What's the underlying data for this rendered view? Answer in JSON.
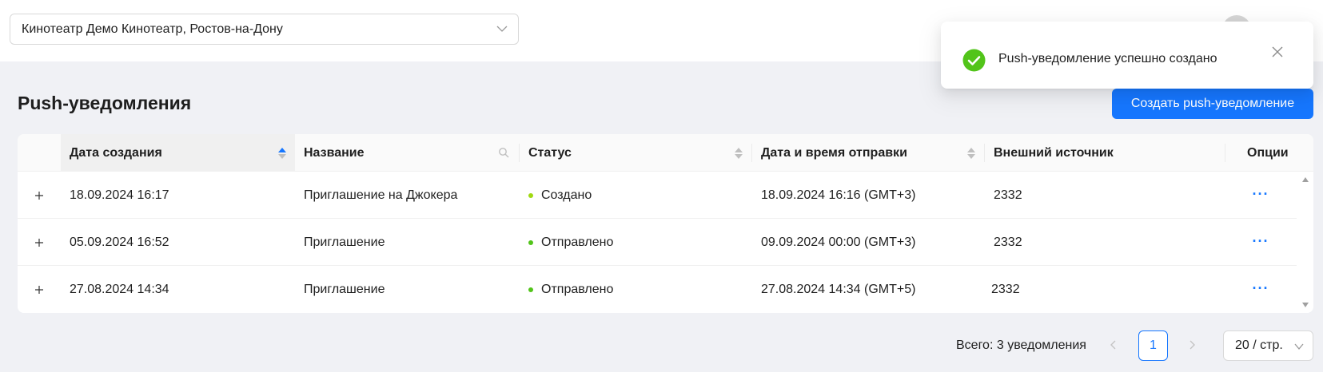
{
  "header": {
    "cinema_select_value": "Кинотеатр Демо Кинотеатр, Ростов-на-Дону"
  },
  "page": {
    "title": "Push-уведомления",
    "create_button_label": "Создать push-уведомление"
  },
  "table": {
    "columns": {
      "created": "Дата создания",
      "name": "Название",
      "status": "Статус",
      "send_datetime": "Дата и время отправки",
      "external_source": "Внешний источник",
      "options": "Опции"
    },
    "rows": [
      {
        "created": "18.09.2024 16:17",
        "name": "Приглашение на Джокера",
        "status": "Создано",
        "status_color": "#a0d911",
        "send_datetime": "18.09.2024 16:16 (GMT+3)",
        "external_source": "2332",
        "options": "···"
      },
      {
        "created": "05.09.2024 16:52",
        "name": "Приглашение",
        "status": "Отправлено",
        "status_color": "#52c41a",
        "send_datetime": "09.09.2024 00:00 (GMT+3)",
        "external_source": "2332",
        "options": "···"
      },
      {
        "created": "27.08.2024 14:34",
        "name": "Приглашение",
        "status": "Отправлено",
        "status_color": "#52c41a",
        "send_datetime": "27.08.2024 14:34 (GMT+5)",
        "external_source": "2332",
        "options": "···"
      }
    ]
  },
  "pagination": {
    "total_text": "Всего: 3 уведомления",
    "current_page": "1",
    "page_size": "20 / стр."
  },
  "toast": {
    "message": "Push-уведомление успешно создано",
    "icon": "check-circle-icon",
    "color": "#52c41a"
  },
  "colors": {
    "accent": "#1677ff",
    "page_bg": "#f0f1f5"
  }
}
